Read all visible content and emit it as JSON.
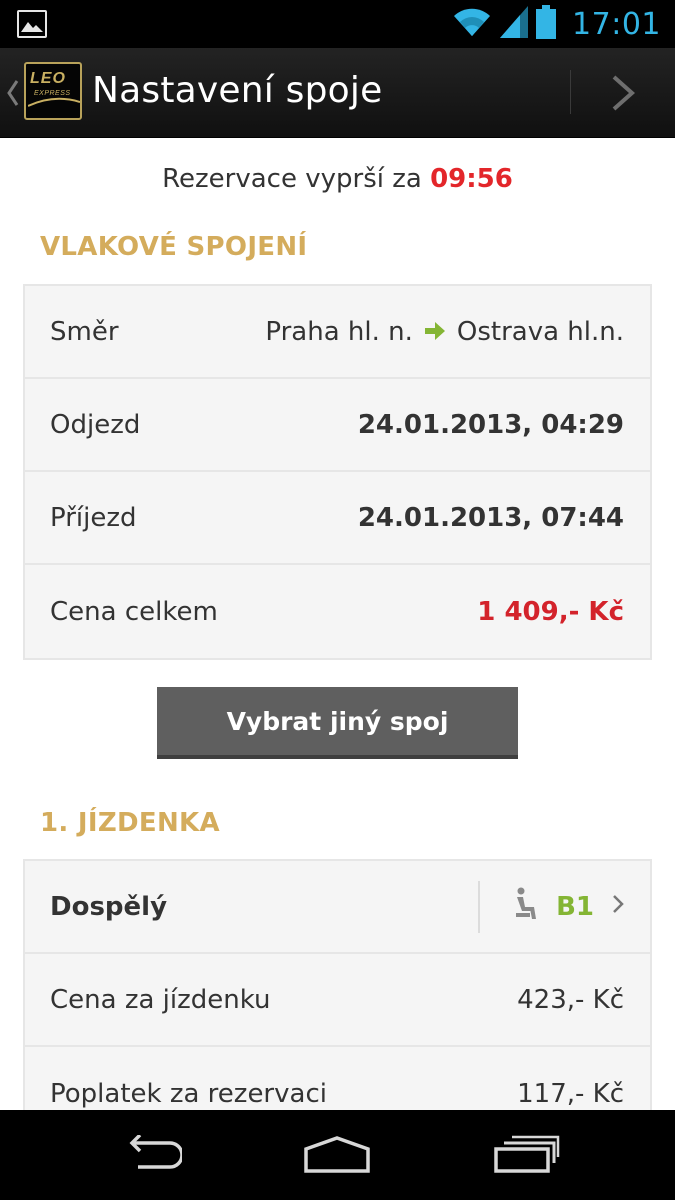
{
  "status_bar": {
    "time": "17:01",
    "icons": [
      "image-notification-icon",
      "wifi-icon",
      "signal-icon",
      "battery-icon"
    ]
  },
  "action_bar": {
    "logo_text": "LEO",
    "logo_sub": "EXPRESS",
    "title": "Nastavení spoje"
  },
  "timer": {
    "label": "Rezervace vyprší za ",
    "value": "09:56"
  },
  "connection": {
    "title": "VLAKOVÉ SPOJENÍ",
    "rows": [
      {
        "label": "Směr",
        "from": "Praha hl. n.",
        "to": "Ostrava hl.n."
      },
      {
        "label": "Odjezd",
        "value": "24.01.2013, 04:29"
      },
      {
        "label": "Příjezd",
        "value": "24.01.2013, 07:44"
      },
      {
        "label": "Cena celkem",
        "value": "1 409,- Kč"
      }
    ],
    "change_button": "Vybrat jiný spoj"
  },
  "ticket": {
    "title": "1. JÍZDENKA",
    "passenger": "Dospělý",
    "seat": "B1",
    "rows": [
      {
        "label": "Cena za jízdenku",
        "value": "423,- Kč"
      },
      {
        "label": "Poplatek za rezervaci",
        "value": "117,- Kč"
      }
    ]
  },
  "colors": {
    "accent_gold": "#d4ac5c",
    "price_red": "#d3232b",
    "seat_green": "#84b534",
    "status_blue": "#33b5e5"
  }
}
